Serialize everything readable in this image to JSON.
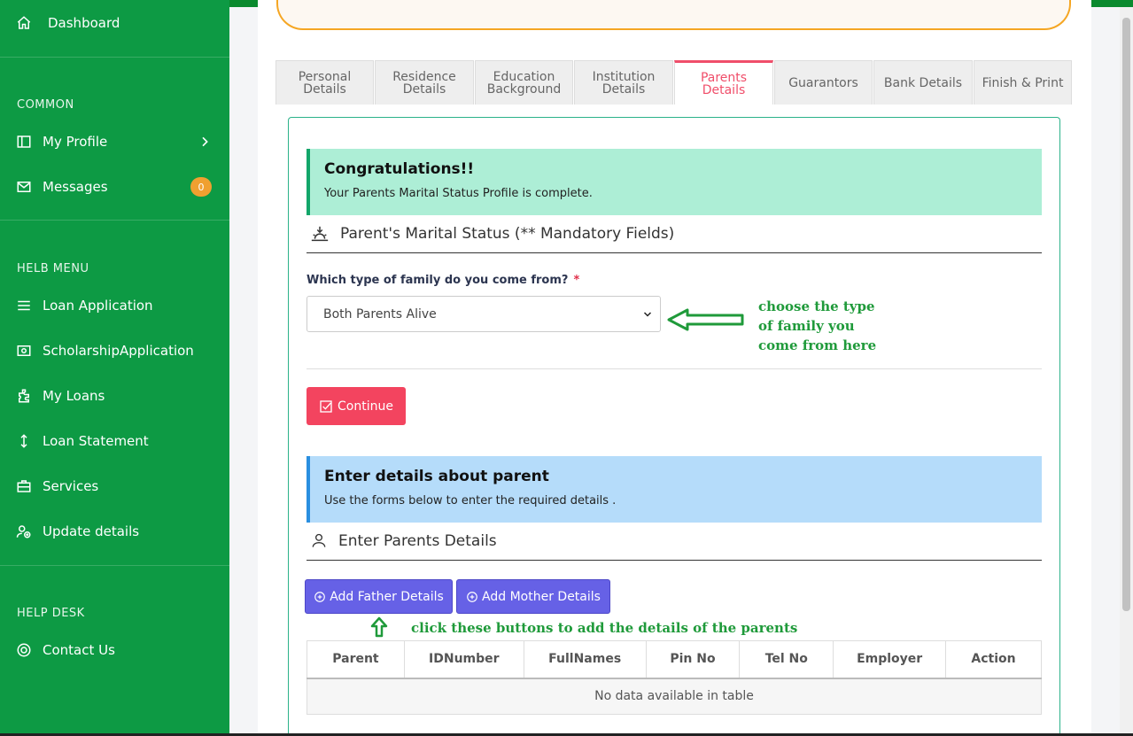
{
  "sidebar": {
    "dashboard": "Dashboard",
    "common_heading": "COMMON",
    "my_profile": "My Profile",
    "messages": "Messages",
    "messages_count": "0",
    "helb_heading": "HELB MENU",
    "loan_application": "Loan Application",
    "scholarship_application": "ScholarshipApplication",
    "my_loans": "My Loans",
    "loan_statement": "Loan Statement",
    "services": "Services",
    "update_details": "Update details",
    "helpdesk_heading": "HELP DESK",
    "contact_us": "Contact Us"
  },
  "tabs": [
    {
      "line1": "Personal",
      "line2": "Details"
    },
    {
      "line1": "Residence",
      "line2": "Details"
    },
    {
      "line1": "Education",
      "line2": "Background"
    },
    {
      "line1": "Institution",
      "line2": "Details"
    },
    {
      "line1": "Parents",
      "line2": "Details"
    },
    {
      "line1": "Guarantors",
      "line2": ""
    },
    {
      "line1": "Bank Details",
      "line2": ""
    },
    {
      "line1": "Finish & Print",
      "line2": ""
    }
  ],
  "success_alert": {
    "title": "Congratulations!!",
    "text": "Your Parents Marital Status Profile is complete."
  },
  "marital_section": {
    "title": "Parent's Marital Status (** Mandatory Fields)",
    "question": "Which type of family do you come from?",
    "required_mark": "*",
    "selected": "Both Parents Alive"
  },
  "continue_label": "Continue",
  "info_alert": {
    "title": "Enter details about parent",
    "text": "Use the forms below to enter the required details ."
  },
  "parents_section": {
    "title": "Enter Parents Details",
    "add_father": "Add Father Details",
    "add_mother": "Add Mother Details"
  },
  "annotations": {
    "family_type_note_line1": "choose the type",
    "family_type_note_line2": "of family you",
    "family_type_note_line3": "come from here",
    "buttons_note": "click these buttons to add the details of the parents"
  },
  "table": {
    "headers": [
      "Parent",
      "IDNumber",
      "FullNames",
      "Pin No",
      "Tel No",
      "Employer",
      "Action"
    ],
    "empty_text": "No data available in table"
  },
  "colors": {
    "sidebar_green": "#0d9a44",
    "active_tab": "#f04e6a",
    "continue_button": "#f3445f",
    "purple_button": "#6661e6",
    "annotation_green": "#1f9a3a"
  }
}
